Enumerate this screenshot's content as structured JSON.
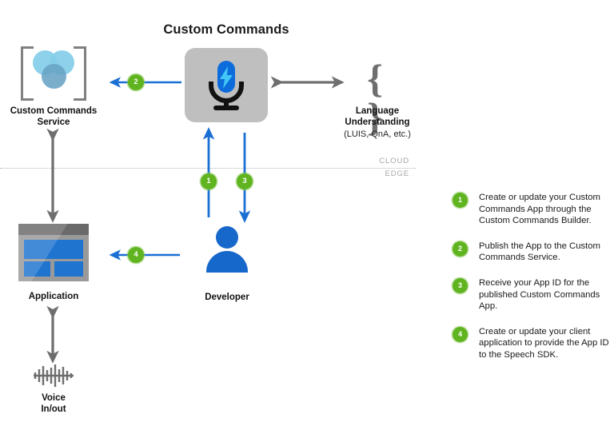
{
  "diagram": {
    "title": "Custom Commands",
    "nodes": {
      "custom_commands_service": {
        "label_line1": "Custom Commands",
        "label_line2": "Service",
        "icon": "three-circles-brackets-icon"
      },
      "custom_commands": {
        "icon": "microphone-bolt-icon"
      },
      "language_understanding": {
        "label_line1": "Language",
        "label_line2": "Understanding",
        "sublabel": "(LUIS, QnA, etc.)",
        "icon": "curly-braces-icon",
        "glyph": "{ }"
      },
      "application": {
        "label": "Application",
        "icon": "browser-window-icon"
      },
      "developer": {
        "label": "Developer",
        "icon": "person-icon"
      },
      "voice": {
        "label_line1": "Voice",
        "label_line2": "In/out",
        "icon": "audio-waveform-icon"
      }
    },
    "divider": {
      "above_label": "CLOUD",
      "below_label": "EDGE"
    },
    "step_markers": {
      "one": "1",
      "two": "2",
      "three": "3",
      "four": "4"
    }
  },
  "legend": {
    "items": [
      {
        "number": "1",
        "text": "Create or update your Custom Commands App through the Custom Commands Builder."
      },
      {
        "number": "2",
        "text": "Publish the App to the Custom Commands Service."
      },
      {
        "number": "3",
        "text": "Receive your App ID for the published Custom Commands App."
      },
      {
        "number": "4",
        "text": "Create or update your client application to provide the App ID to the Speech SDK."
      }
    ]
  },
  "colors": {
    "blue_arrow": "#1a6fd4",
    "gray_arrow": "#6e6e6e",
    "step_green": "#5fb41f",
    "tile_gray": "#bfbfbf",
    "mic_blue": "#0d6cdb",
    "bolt_cyan": "#41c6f5",
    "service_circle_light": "#84cde8",
    "service_circle_dark": "#68a3c4",
    "app_blue": "#1f74cf",
    "developer_blue": "#1668ca",
    "divider_gray": "#b3b3b3"
  }
}
